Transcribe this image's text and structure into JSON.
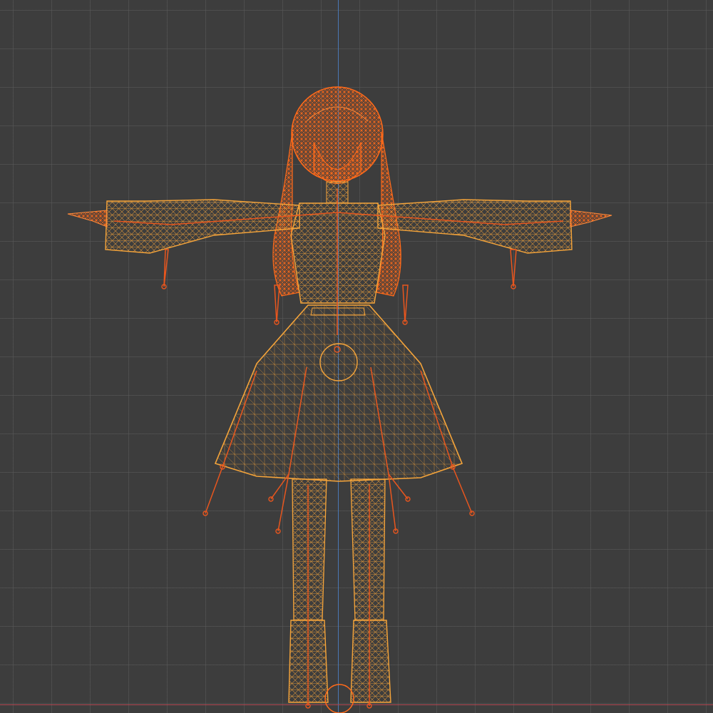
{
  "viewport": {
    "view": "front-orthographic",
    "shading": "wireframe",
    "colors": {
      "background": "#3d3d3d",
      "grid": "#5a5a5a",
      "axis_y": "#4a78b5",
      "axis_x": "#b0454f",
      "mesh_selected": "#f5a43a",
      "mesh_active": "#ff6a1a",
      "bones": "#e8561e"
    }
  },
  "scene": {
    "object": {
      "kind": "character-mesh",
      "pose": "T-pose",
      "selected": true
    },
    "armature": {
      "visible": true
    }
  }
}
